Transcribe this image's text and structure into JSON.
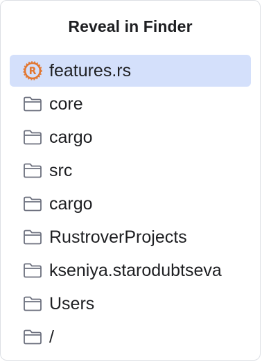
{
  "popup": {
    "title": "Reveal in Finder",
    "items": [
      {
        "label": "features.rs",
        "icon": "rust-file-icon",
        "selected": true
      },
      {
        "label": "core",
        "icon": "folder-icon",
        "selected": false
      },
      {
        "label": "cargo",
        "icon": "folder-icon",
        "selected": false
      },
      {
        "label": "src",
        "icon": "folder-icon",
        "selected": false
      },
      {
        "label": "cargo",
        "icon": "folder-icon",
        "selected": false
      },
      {
        "label": "RustroverProjects",
        "icon": "folder-icon",
        "selected": false
      },
      {
        "label": "kseniya.starodubtseva",
        "icon": "folder-icon",
        "selected": false
      },
      {
        "label": "Users",
        "icon": "folder-icon",
        "selected": false
      },
      {
        "label": "/",
        "icon": "folder-icon",
        "selected": false
      }
    ]
  },
  "colors": {
    "selection": "#d4e0fb",
    "rust_icon": "#e2762f",
    "folder_outline": "#6c707e"
  }
}
